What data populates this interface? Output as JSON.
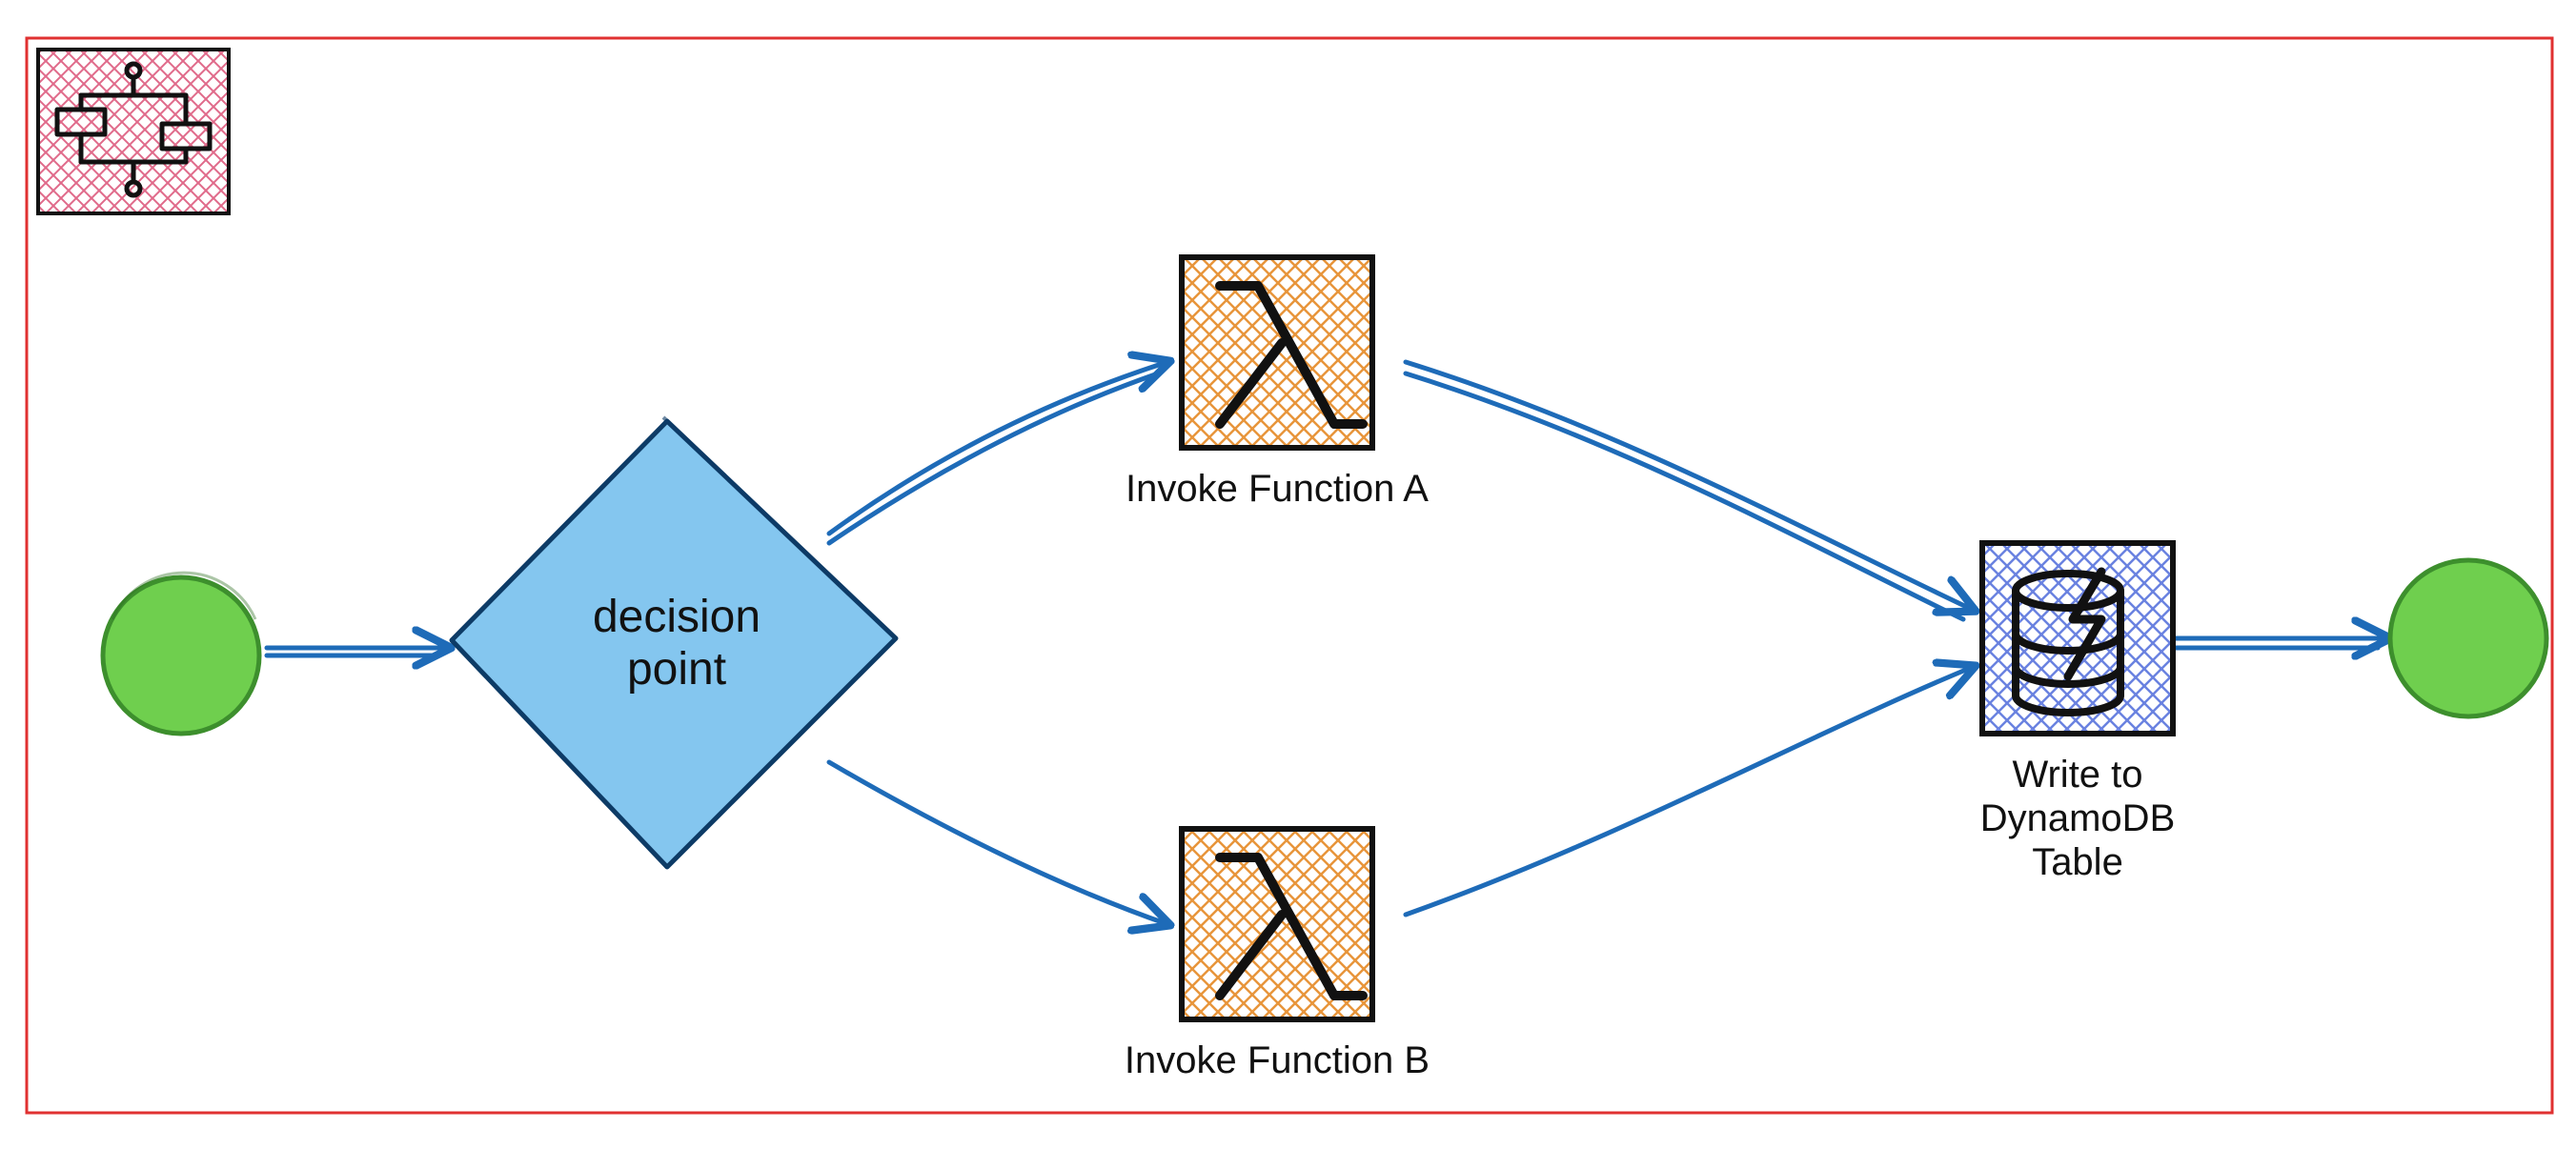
{
  "diagram": {
    "type": "flowchart",
    "style": "hand-drawn / excalidraw",
    "containerIcon": "step-functions-icon",
    "nodes": {
      "start": {
        "kind": "start-circle",
        "label": ""
      },
      "decision": {
        "kind": "decision-diamond",
        "label": "decision\npoint"
      },
      "funcA": {
        "kind": "lambda-task",
        "label": "Invoke Function A"
      },
      "funcB": {
        "kind": "lambda-task",
        "label": "Invoke Function B"
      },
      "ddb": {
        "kind": "dynamodb-task",
        "label": "Write to\nDynamoDB\nTable"
      },
      "end": {
        "kind": "end-circle",
        "label": ""
      }
    },
    "edges": [
      [
        "start",
        "decision"
      ],
      [
        "decision",
        "funcA"
      ],
      [
        "decision",
        "funcB"
      ],
      [
        "funcA",
        "ddb"
      ],
      [
        "funcB",
        "ddb"
      ],
      [
        "ddb",
        "end"
      ]
    ],
    "colors": {
      "arrow": "#1e6bb8",
      "startFill": "#6fcf4e",
      "decisionFill": "#84c6ef",
      "lambdaHatch": "#e8953b",
      "ddbHatch": "#3f5fd6",
      "containerBorder": "#e03131",
      "containerHatch": "#e06a8a"
    }
  }
}
